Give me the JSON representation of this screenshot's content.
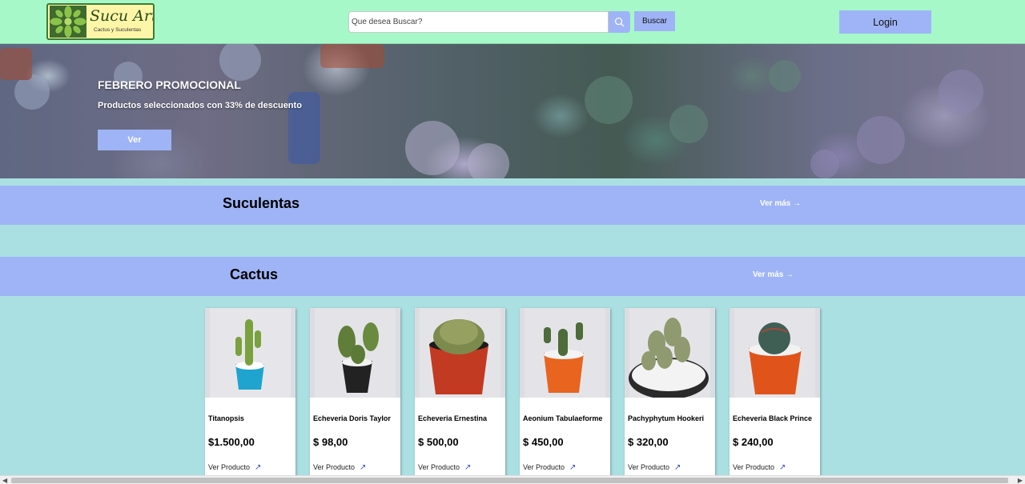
{
  "header": {
    "logo_title": "Sucu Art",
    "logo_subtitle": "Cactus y Suculentas",
    "search_placeholder": "Que desea Buscar?",
    "search_icon": "search-icon",
    "buscar_label": "Buscar",
    "login_label": "Login",
    "background_color": "#a6f8c9",
    "accent_color": "#9fb4f6"
  },
  "banner": {
    "title": "FEBRERO PROMOCIONAL",
    "subtitle": "Productos seleccionados con 33% de descuento",
    "button_label": "Ver"
  },
  "categories": [
    {
      "title": "Suculentas",
      "more_label": "Ver más"
    },
    {
      "title": "Cactus",
      "more_label": "Ver más"
    }
  ],
  "products": [
    {
      "name": "Titanopsis",
      "price": "$1.500,00",
      "link_label": "Ver Producto"
    },
    {
      "name": "Echeveria Doris Taylor",
      "price": "$ 98,00",
      "link_label": "Ver Producto"
    },
    {
      "name": "Echeveria Ernestina",
      "price": "$ 500,00",
      "link_label": "Ver Producto"
    },
    {
      "name": "Aeonium Tabulaeforme",
      "price": "$ 450,00",
      "link_label": "Ver Producto"
    },
    {
      "name": "Pachyphytum Hookeri",
      "price": "$ 320,00",
      "link_label": "Ver Producto"
    },
    {
      "name": "Echeveria Black Prince",
      "price": "$ 240,00",
      "link_label": "Ver Producto"
    }
  ],
  "page_background": "#abe0e3"
}
